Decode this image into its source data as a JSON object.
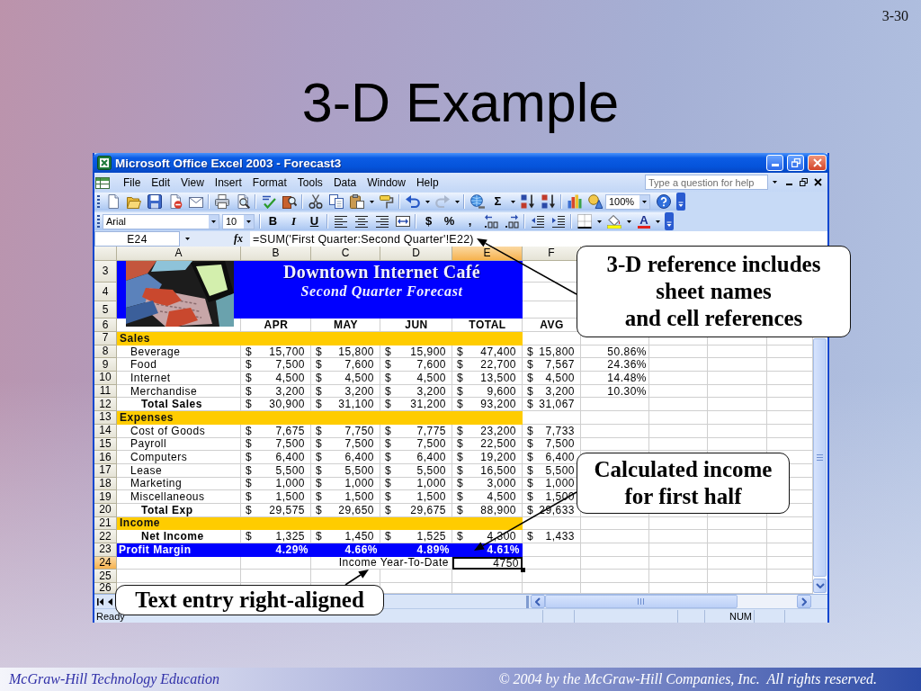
{
  "slide": {
    "page_number": "3-30",
    "title": "3-D Example"
  },
  "excel": {
    "title": "Microsoft Office Excel 2003 - Forecast3",
    "menu": [
      "File",
      "Edit",
      "View",
      "Insert",
      "Format",
      "Tools",
      "Data",
      "Window",
      "Help"
    ],
    "help_box": {
      "placeholder": "Type a question for help"
    },
    "standard_toolbar": {
      "autosum": "Σ",
      "zoom": "100%",
      "redo": {
        "disabled": true
      }
    },
    "formatting_toolbar": {
      "font": "Arial",
      "size": "10",
      "style_buttons": [
        "B",
        "I",
        "U"
      ],
      "number_buttons": [
        "$",
        "%",
        ","
      ],
      "font_color": "A"
    },
    "formula_bar": {
      "name_box": "E24",
      "function_button": "fx",
      "formula": "=SUM('First Quarter:Second Quarter'!E22)"
    },
    "columns": [
      {
        "label": "A",
        "selected": false
      },
      {
        "label": "B",
        "selected": false
      },
      {
        "label": "C",
        "selected": false
      },
      {
        "label": "D",
        "selected": false
      },
      {
        "label": "E",
        "selected": true
      },
      {
        "label": "F",
        "selected": false
      }
    ],
    "rows": [
      {
        "number": "3",
        "kind": "banner_title",
        "selected": false,
        "text": "Downtown Internet Café"
      },
      {
        "number": "4",
        "kind": "banner_subtitle",
        "selected": false,
        "text": "Second Quarter Forecast"
      },
      {
        "number": "5",
        "kind": "banner_blank",
        "selected": false
      },
      {
        "number": "6",
        "kind": "header",
        "selected": false,
        "cells": [
          "APR",
          "MAY",
          "JUN",
          "TOTAL",
          "AVG"
        ]
      },
      {
        "number": "7",
        "kind": "section",
        "selected": false,
        "label": "Sales"
      },
      {
        "number": "8",
        "kind": "item",
        "selected": false,
        "label": "Beverage",
        "values": [
          [
            "$",
            "15,700"
          ],
          [
            "$",
            "15,800"
          ],
          [
            "$",
            "15,900"
          ],
          [
            "$",
            "47,400"
          ],
          [
            "$",
            "15,800"
          ]
        ],
        "share": "50.86%"
      },
      {
        "number": "9",
        "kind": "item",
        "selected": false,
        "label": "Food",
        "values": [
          [
            "$",
            "7,500"
          ],
          [
            "$",
            "7,600"
          ],
          [
            "$",
            "7,600"
          ],
          [
            "$",
            "22,700"
          ],
          [
            "$",
            "7,567"
          ]
        ],
        "share": "24.36%"
      },
      {
        "number": "10",
        "kind": "item",
        "selected": false,
        "label": "Internet",
        "values": [
          [
            "$",
            "4,500"
          ],
          [
            "$",
            "4,500"
          ],
          [
            "$",
            "4,500"
          ],
          [
            "$",
            "13,500"
          ],
          [
            "$",
            "4,500"
          ]
        ],
        "share": "14.48%"
      },
      {
        "number": "11",
        "kind": "item",
        "selected": false,
        "label": "Merchandise",
        "values": [
          [
            "$",
            "3,200"
          ],
          [
            "$",
            "3,200"
          ],
          [
            "$",
            "3,200"
          ],
          [
            "$",
            "9,600"
          ],
          [
            "$",
            "3,200"
          ]
        ],
        "share": "10.30%"
      },
      {
        "number": "12",
        "kind": "total",
        "selected": false,
        "label": "Total Sales",
        "values": [
          [
            "$",
            "30,900"
          ],
          [
            "$",
            "31,100"
          ],
          [
            "$",
            "31,200"
          ],
          [
            "$",
            "93,200"
          ],
          [
            "$",
            "31,067"
          ]
        ]
      },
      {
        "number": "13",
        "kind": "section",
        "selected": false,
        "label": "Expenses"
      },
      {
        "number": "14",
        "kind": "item",
        "selected": false,
        "label": "Cost of Goods",
        "values": [
          [
            "$",
            "7,675"
          ],
          [
            "$",
            "7,750"
          ],
          [
            "$",
            "7,775"
          ],
          [
            "$",
            "23,200"
          ],
          [
            "$",
            "7,733"
          ]
        ]
      },
      {
        "number": "15",
        "kind": "item",
        "selected": false,
        "label": "Payroll",
        "values": [
          [
            "$",
            "7,500"
          ],
          [
            "$",
            "7,500"
          ],
          [
            "$",
            "7,500"
          ],
          [
            "$",
            "22,500"
          ],
          [
            "$",
            "7,500"
          ]
        ]
      },
      {
        "number": "16",
        "kind": "item",
        "selected": false,
        "label": "Computers",
        "values": [
          [
            "$",
            "6,400"
          ],
          [
            "$",
            "6,400"
          ],
          [
            "$",
            "6,400"
          ],
          [
            "$",
            "19,200"
          ],
          [
            "$",
            "6,400"
          ]
        ]
      },
      {
        "number": "17",
        "kind": "item",
        "selected": false,
        "label": "Lease",
        "values": [
          [
            "$",
            "5,500"
          ],
          [
            "$",
            "5,500"
          ],
          [
            "$",
            "5,500"
          ],
          [
            "$",
            "16,500"
          ],
          [
            "$",
            "5,500"
          ]
        ]
      },
      {
        "number": "18",
        "kind": "item",
        "selected": false,
        "label": "Marketing",
        "values": [
          [
            "$",
            "1,000"
          ],
          [
            "$",
            "1,000"
          ],
          [
            "$",
            "1,000"
          ],
          [
            "$",
            "3,000"
          ],
          [
            "$",
            "1,000"
          ]
        ]
      },
      {
        "number": "19",
        "kind": "item",
        "selected": false,
        "label": "Miscellaneous",
        "values": [
          [
            "$",
            "1,500"
          ],
          [
            "$",
            "1,500"
          ],
          [
            "$",
            "1,500"
          ],
          [
            "$",
            "4,500"
          ],
          [
            "$",
            "1,500"
          ]
        ]
      },
      {
        "number": "20",
        "kind": "total",
        "selected": false,
        "label": "Total Exp",
        "values": [
          [
            "$",
            "29,575"
          ],
          [
            "$",
            "29,650"
          ],
          [
            "$",
            "29,675"
          ],
          [
            "$",
            "88,900"
          ],
          [
            "$",
            "29,633"
          ]
        ]
      },
      {
        "number": "21",
        "kind": "section",
        "selected": false,
        "label": "Income"
      },
      {
        "number": "22",
        "kind": "total",
        "selected": false,
        "label": "Net Income",
        "values": [
          [
            "$",
            "1,325"
          ],
          [
            "$",
            "1,450"
          ],
          [
            "$",
            "1,525"
          ],
          [
            "$",
            "4,300"
          ],
          [
            "$",
            "1,433"
          ]
        ]
      },
      {
        "number": "23",
        "kind": "margin",
        "selected": false,
        "label": "Profit Margin",
        "values": [
          "4.29%",
          "4.66%",
          "4.89%",
          "4.61%"
        ]
      },
      {
        "number": "24",
        "kind": "entry",
        "selected": true,
        "caption": "Income Year-To-Date",
        "value": "4750"
      },
      {
        "number": "25",
        "kind": "blank",
        "selected": false
      },
      {
        "number": "26",
        "kind": "blank",
        "selected": false
      }
    ],
    "status_bar": {
      "mode": "Ready",
      "indicator": "NUM"
    }
  },
  "callouts": [
    {
      "lines": [
        "3-D reference includes",
        "sheet names",
        "and cell references"
      ]
    },
    {
      "lines": [
        "Calculated income",
        "for first half"
      ]
    },
    {
      "lines": [
        "Text entry right-aligned"
      ]
    }
  ],
  "footer": {
    "left": "McGraw-Hill Technology Education",
    "right": "© 2004 by the McGraw-Hill Companies, Inc.  All rights reserved."
  }
}
